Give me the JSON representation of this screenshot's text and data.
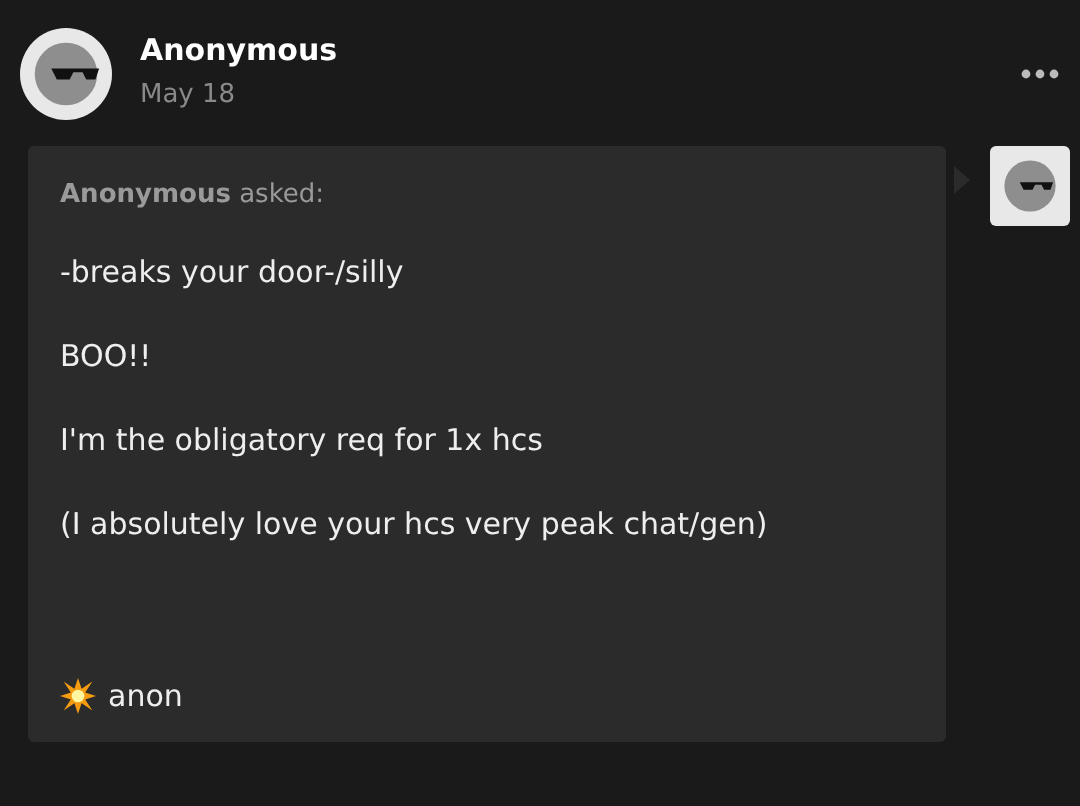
{
  "post": {
    "author": "Anonymous",
    "date": "May 18"
  },
  "ask": {
    "asker": "Anonymous",
    "asked_label": "asked:",
    "paragraphs": [
      "-breaks your door-/silly",
      "BOO!!",
      "I'm the obligatory req for 1x hcs",
      "(I absolutely love your hcs very peak chat/gen)"
    ],
    "signoff": "anon"
  }
}
